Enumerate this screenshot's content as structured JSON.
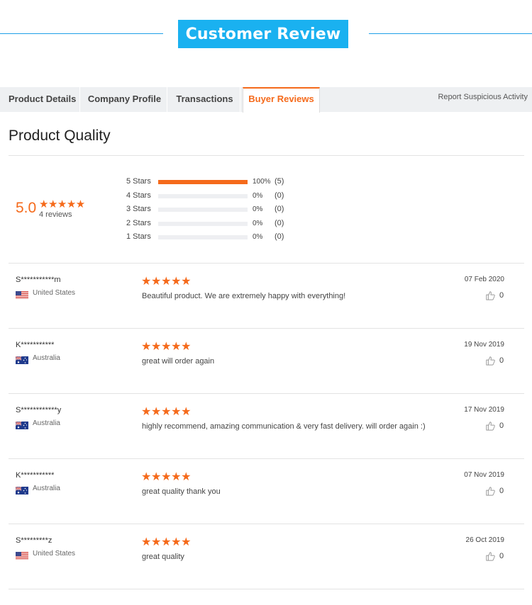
{
  "banner": {
    "title": "Customer Review"
  },
  "tabs": [
    {
      "label": "Product Details"
    },
    {
      "label": "Company Profile"
    },
    {
      "label": "Transactions"
    },
    {
      "label": "Buyer Reviews",
      "active": true
    }
  ],
  "report_link": "Report Suspicious Activity",
  "section_title": "Product Quality",
  "summary": {
    "score": "5.0",
    "stars": "★★★★★",
    "review_count": "4 reviews"
  },
  "distribution": [
    {
      "label": "5  Stars",
      "pct_text": "100%",
      "count_text": "(5)",
      "fraction": 1.0
    },
    {
      "label": "4  Stars",
      "pct_text": "0%",
      "count_text": "(0)",
      "fraction": 0
    },
    {
      "label": "3  Stars",
      "pct_text": "0%",
      "count_text": "(0)",
      "fraction": 0
    },
    {
      "label": "2  Stars",
      "pct_text": "0%",
      "count_text": "(0)",
      "fraction": 0
    },
    {
      "label": "1  Stars",
      "pct_text": "0%",
      "count_text": "(0)",
      "fraction": 0
    }
  ],
  "reviews": [
    {
      "name": "S***********m",
      "country": "United States",
      "flag": "us",
      "stars": "★★★★★",
      "text": "Beautiful product. We are extremely happy with everything!",
      "date": "07 Feb 2020",
      "likes": "0"
    },
    {
      "name": "K***********",
      "country": "Australia",
      "flag": "au",
      "stars": "★★★★★",
      "text": "great will order again",
      "date": "19 Nov 2019",
      "likes": "0"
    },
    {
      "name": "S************y",
      "country": "Australia",
      "flag": "au",
      "stars": "★★★★★",
      "text": "highly recommend, amazing communication & very fast delivery. will order again :)",
      "date": "17 Nov 2019",
      "likes": "0"
    },
    {
      "name": "K***********",
      "country": "Australia",
      "flag": "au",
      "stars": "★★★★★",
      "text": "great quality thank you",
      "date": "07 Nov 2019",
      "likes": "0"
    },
    {
      "name": "S*********z",
      "country": "United States",
      "flag": "us",
      "stars": "★★★★★",
      "text": "great quality",
      "date": "26 Oct 2019",
      "likes": "0"
    }
  ],
  "colors": {
    "accent": "#f56a1b",
    "banner": "#1ab1f0"
  },
  "icons": {
    "like": "thumbs-up-icon"
  }
}
